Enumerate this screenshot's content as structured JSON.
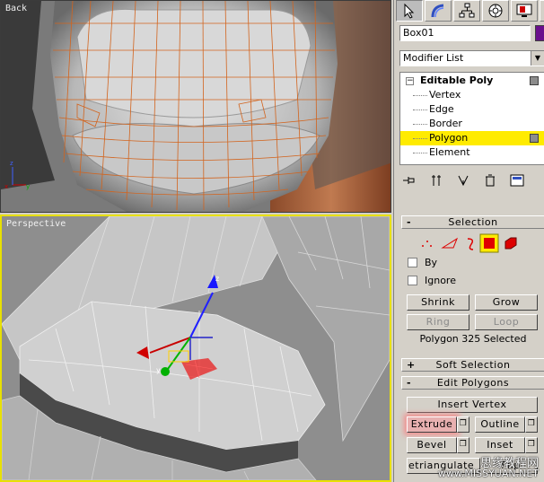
{
  "viewports": {
    "back": {
      "label": "Back"
    },
    "perspective": {
      "label": "Perspective"
    }
  },
  "command_panel": {
    "tabs": [
      {
        "name": "create-tab",
        "icon": "cursor-arrow-icon",
        "active": true
      },
      {
        "name": "modify-tab",
        "icon": "bend-icon"
      },
      {
        "name": "hierarchy-tab",
        "icon": "hierarchy-icon"
      },
      {
        "name": "motion-tab",
        "icon": "motion-icon"
      },
      {
        "name": "display-tab",
        "icon": "display-monitor-icon"
      },
      {
        "name": "utilities-tab",
        "icon": "hammer-icon"
      }
    ],
    "object_name": "Box01",
    "object_color": "#6a0f8c",
    "modifier_list": "Modifier List",
    "stack": {
      "root": "Editable Poly",
      "items": [
        "Vertex",
        "Edge",
        "Border",
        "Polygon",
        "Element"
      ],
      "selected": "Polygon"
    }
  },
  "selection": {
    "title": "Selection",
    "collapse_sign": "-",
    "by_label": "By",
    "ignore_label": "Ignore",
    "shrink": "Shrink",
    "grow": "Grow",
    "ring": "Ring",
    "loop": "Loop",
    "status": "Polygon 325 Selected"
  },
  "soft_selection": {
    "title": "Soft Selection",
    "expand_sign": "+"
  },
  "edit_polygons": {
    "title": "Edit Polygons",
    "collapse_sign": "-",
    "insert_vertex": "Insert Vertex",
    "extrude": "Extrude",
    "outline": "Outline",
    "bevel": "Bevel",
    "inset": "Inset",
    "retriangulate": "etriangulate",
    "flip": "Flip",
    "settings_glyph": "❐"
  },
  "watermark": {
    "line1": "思缘教程网",
    "line2": "www.MISSYUAN.NET"
  }
}
